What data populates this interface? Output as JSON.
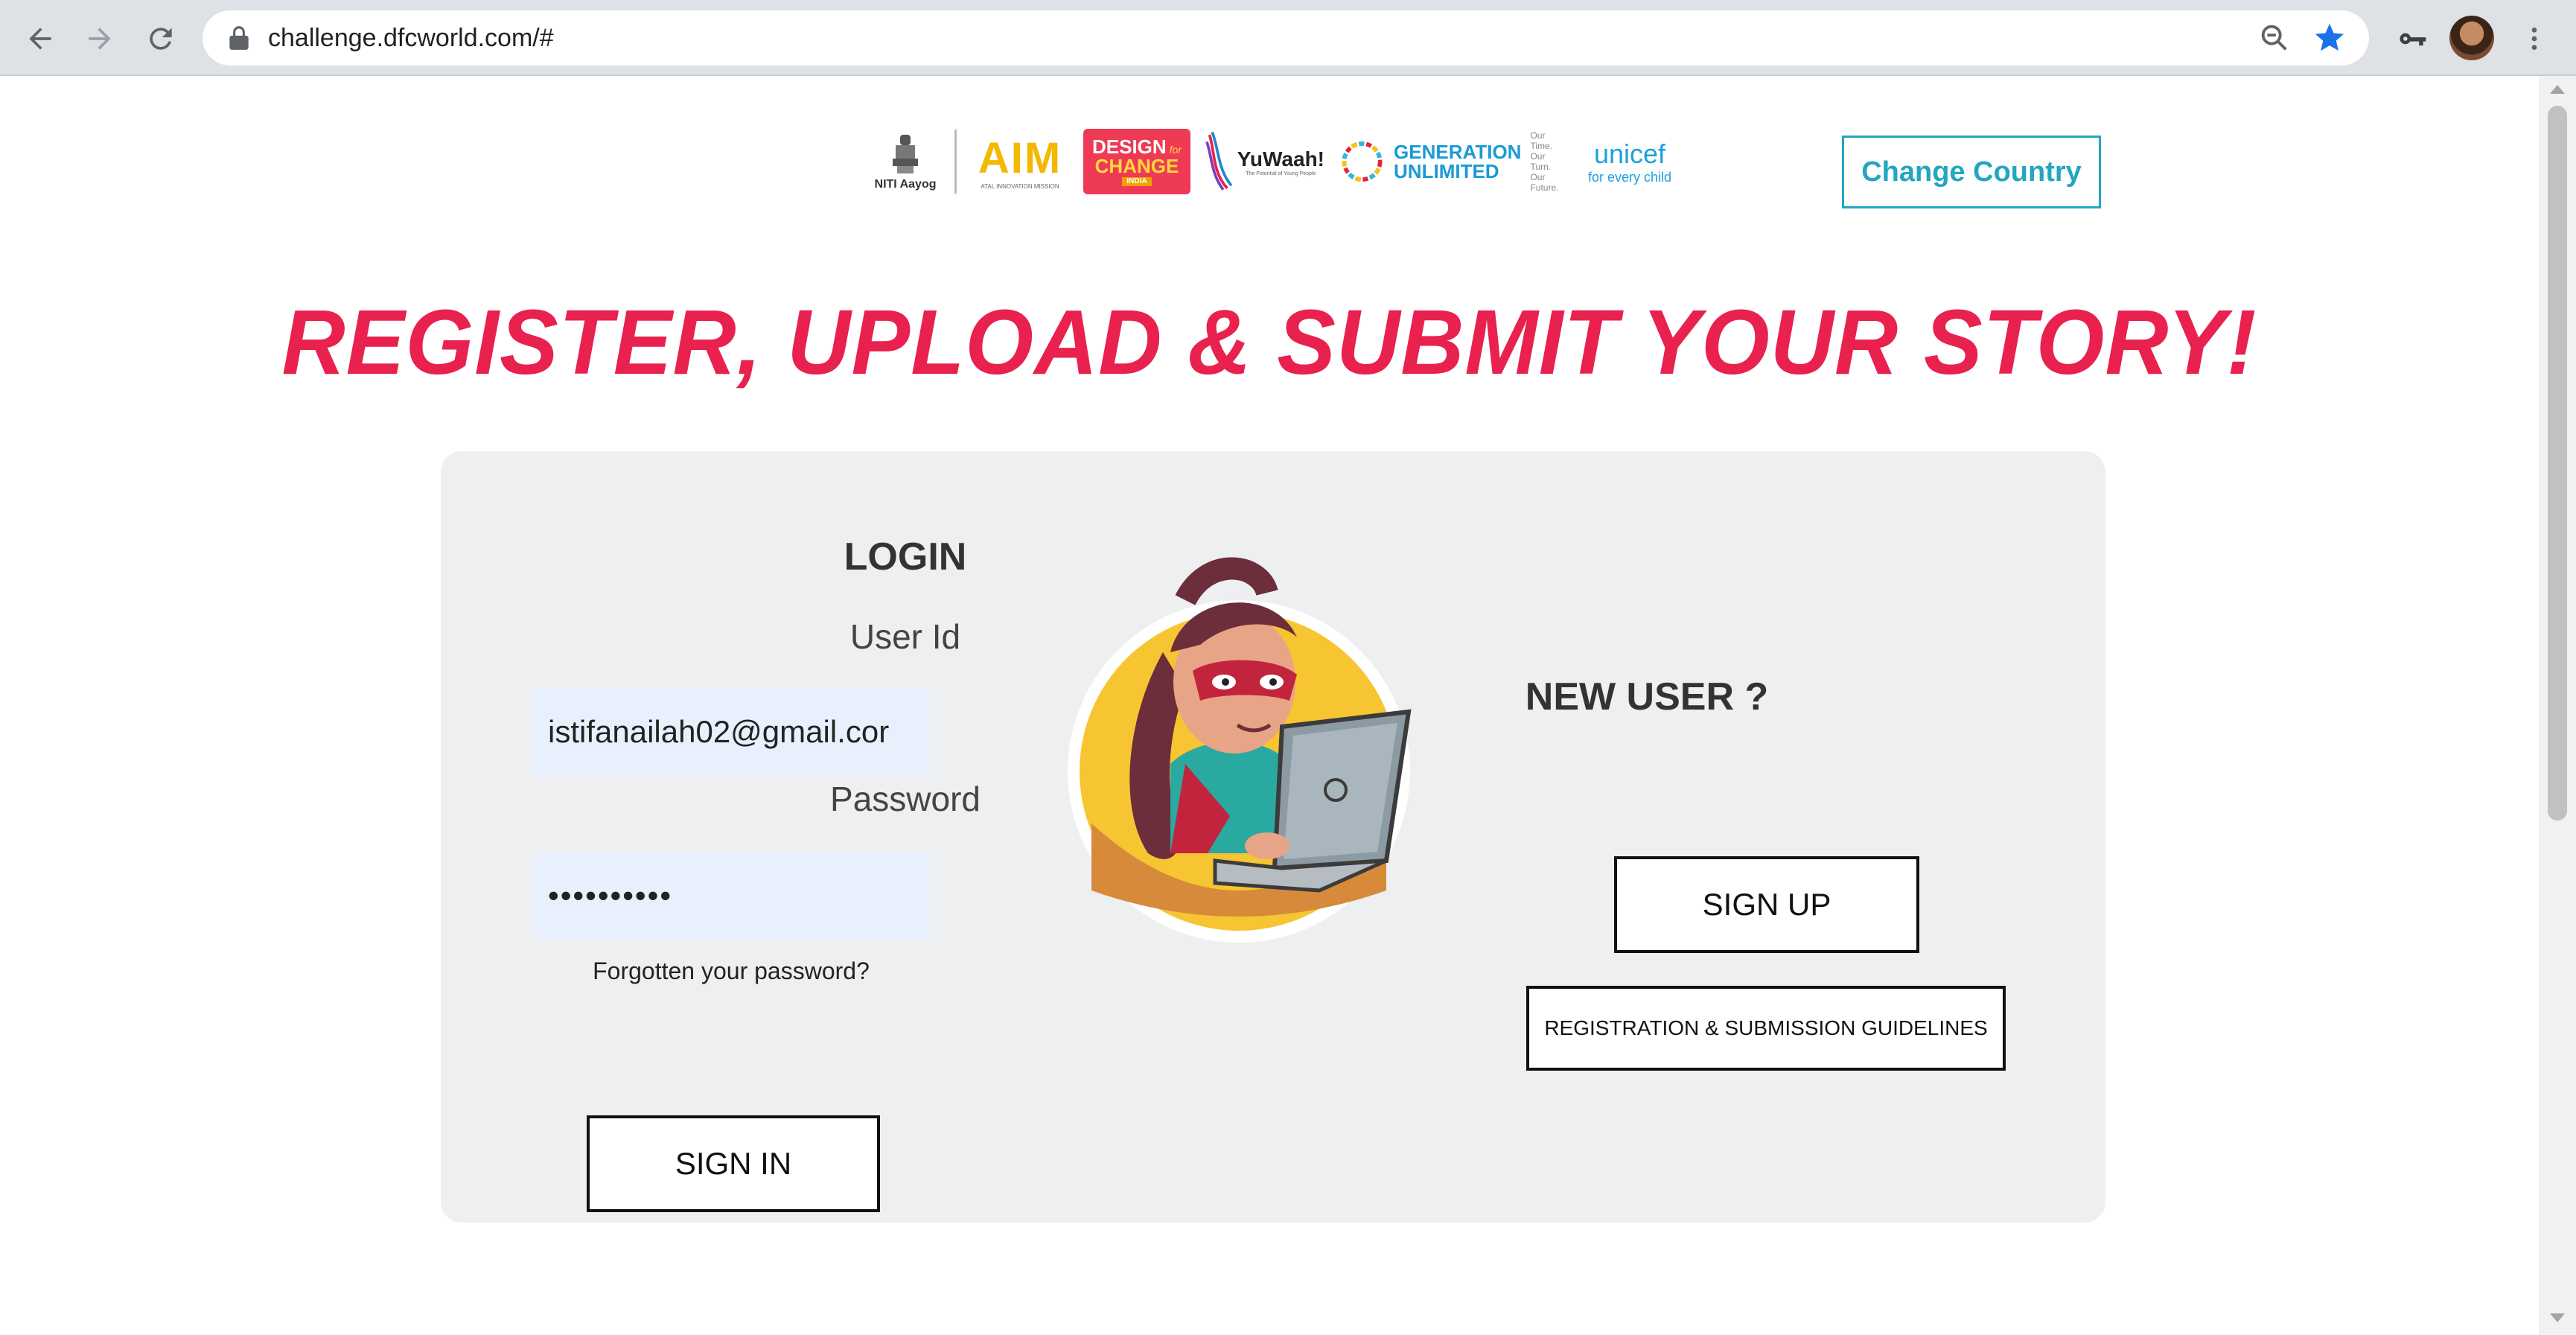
{
  "browser": {
    "url": "challenge.dfcworld.com/#"
  },
  "logos": {
    "niti_caption": "NITI Aayog",
    "aim_text": "AIM",
    "aim_caption": "ATAL INNOVATION MISSION",
    "dfc_line1": "DESIGN",
    "dfc_for": "for",
    "dfc_line2": "CHANGE",
    "dfc_line3": "INDIA",
    "yuwaah_text": "YuWaah!",
    "yuwaah_caption": "The Potential of Young People",
    "genu_line1": "GENERATION",
    "genu_line2": "UNLIMITED",
    "genu_tag1": "Our Time.",
    "genu_tag2": "Our Turn.",
    "genu_tag3": "Our Future.",
    "unicef_text": "unicef",
    "unicef_tag": "for every child"
  },
  "header": {
    "change_country_label": "Change Country"
  },
  "main": {
    "headline": "REGISTER, UPLOAD & SUBMIT YOUR STORY!"
  },
  "login": {
    "title": "LOGIN",
    "user_id_label": "User Id",
    "user_id_value": "istifanailah02@gmail.cor",
    "password_label": "Password",
    "password_value": "••••••••••",
    "forgot_label": "Forgotten your password?",
    "sign_in_label": "SIGN IN"
  },
  "new_user": {
    "title": "NEW USER ?",
    "sign_up_label": "SIGN UP",
    "guidelines_label": "REGISTRATION & SUBMISSION GUIDELINES"
  },
  "colors": {
    "accent": "#e8214e",
    "link": "#23a6c0",
    "panel": "#eeeff1"
  }
}
